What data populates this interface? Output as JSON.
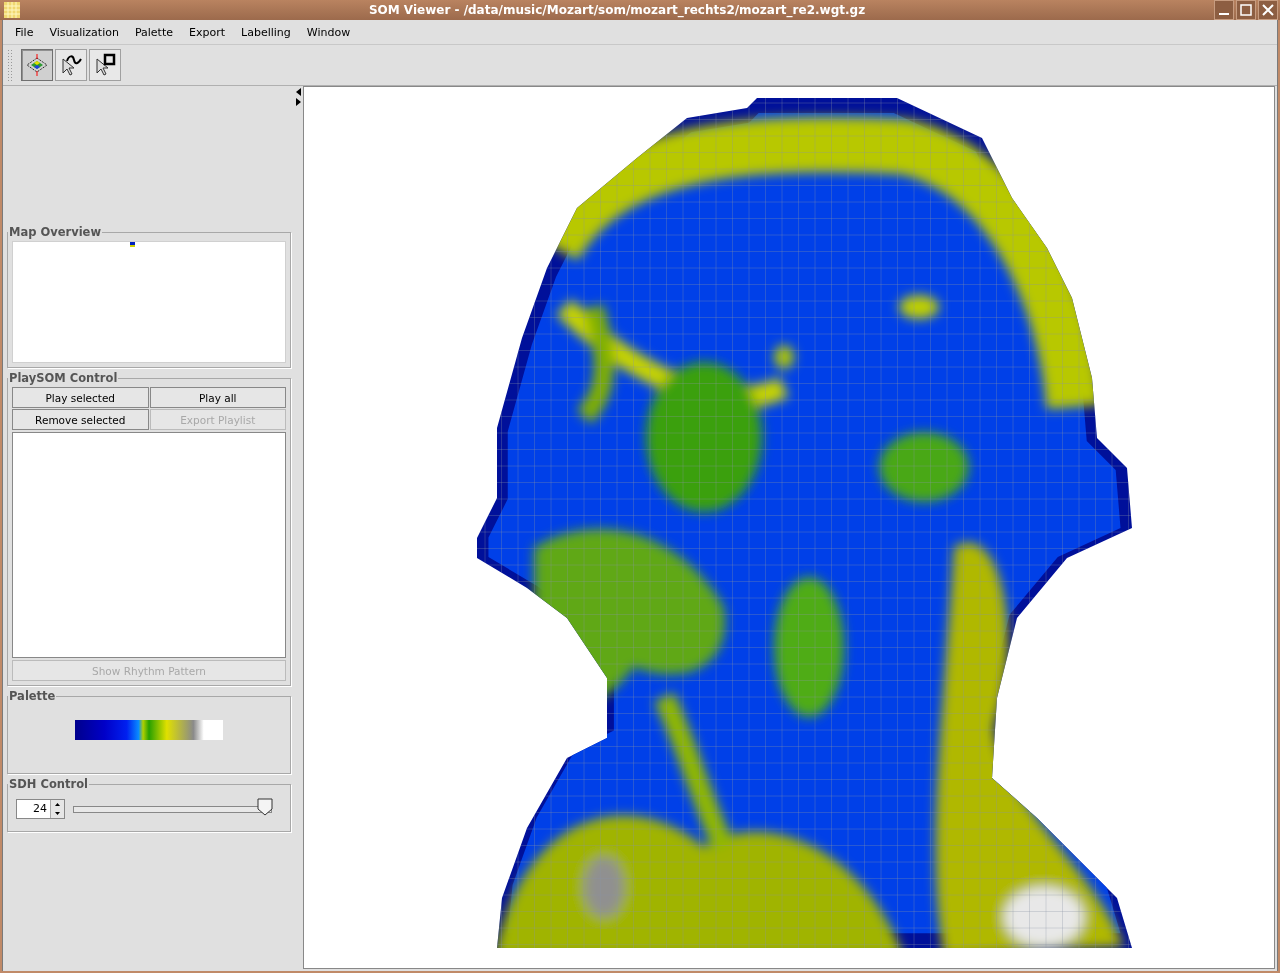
{
  "window": {
    "title": "SOM Viewer - /data/music/Mozart/som/mozart_rechts2/mozart_re2.wgt.gz"
  },
  "menu": [
    {
      "label": "File"
    },
    {
      "label": "Visualization"
    },
    {
      "label": "Palette"
    },
    {
      "label": "Export"
    },
    {
      "label": "Labelling"
    },
    {
      "label": "Window"
    }
  ],
  "toolbar": [
    {
      "kind": "map",
      "selected": true
    },
    {
      "kind": "lasso",
      "selected": false
    },
    {
      "kind": "rect",
      "selected": false
    }
  ],
  "map_overview": {
    "title": "Map Overview"
  },
  "playsom": {
    "title": "PlaySOM Control",
    "buttons": [
      {
        "label": "Play selected",
        "disabled": false
      },
      {
        "label": "Play all",
        "disabled": false
      },
      {
        "label": "Remove selected",
        "disabled": false
      },
      {
        "label": "Export Playlist",
        "disabled": true
      }
    ],
    "rhythm_button": {
      "label": "Show Rhythm Pattern",
      "disabled": true
    }
  },
  "palette": {
    "title": "Palette"
  },
  "sdh": {
    "title": "SDH Control",
    "value": "24",
    "level": 0.97
  }
}
